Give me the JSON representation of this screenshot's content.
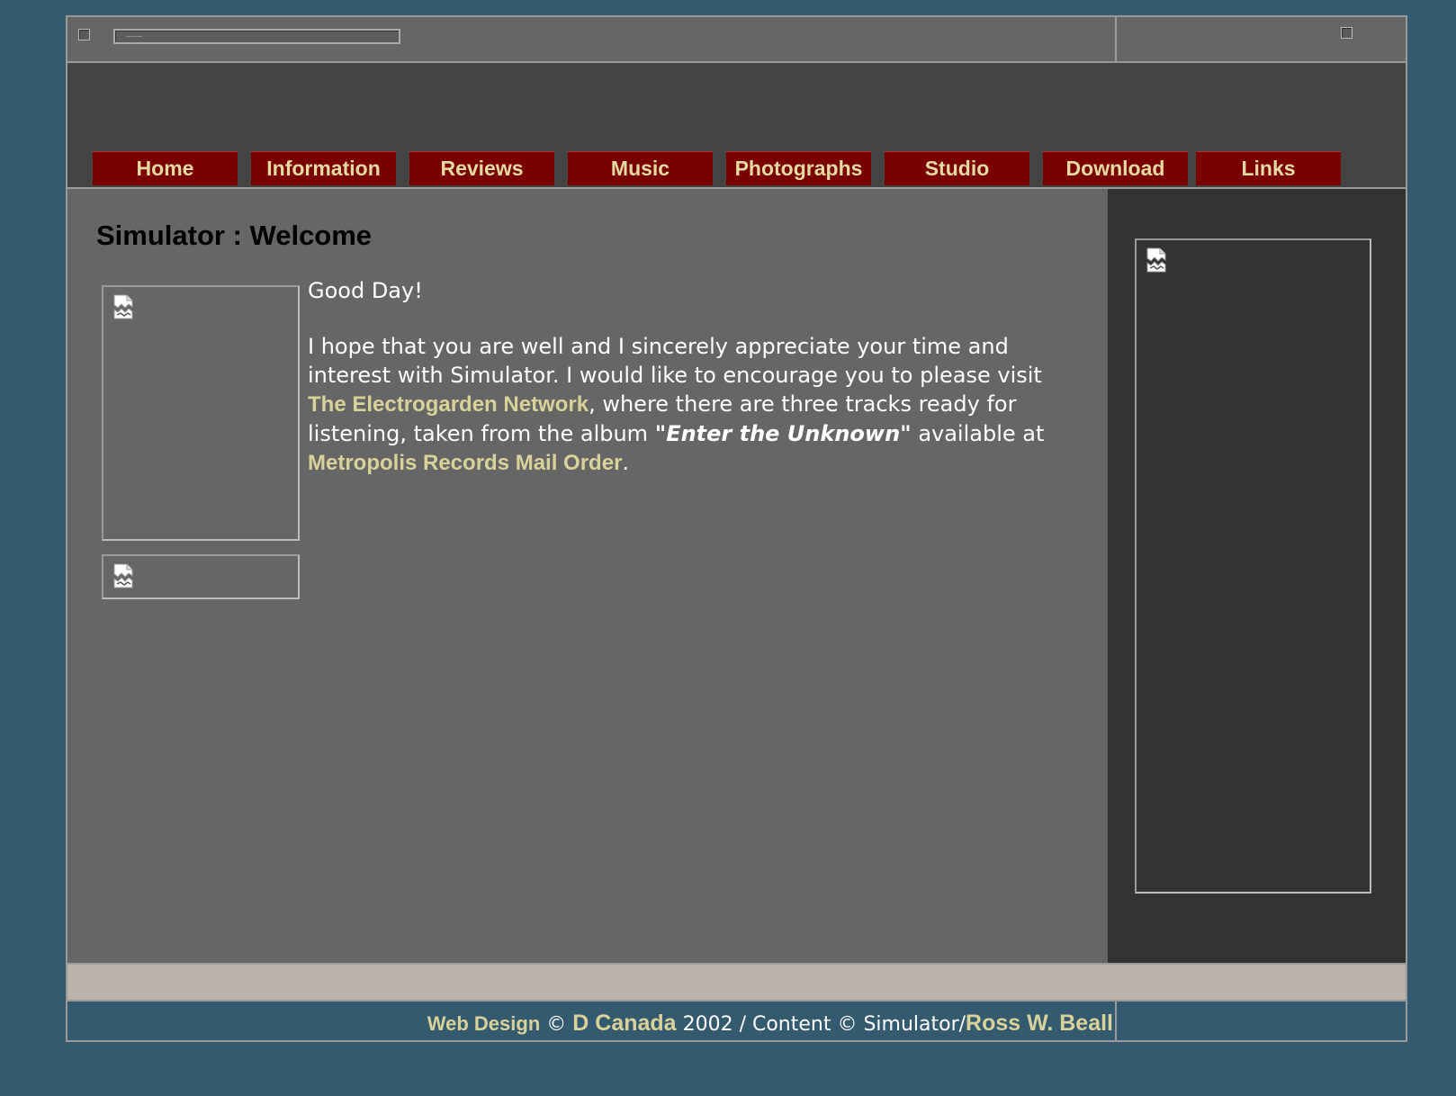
{
  "nav": {
    "items": [
      "Home",
      "Information",
      "Reviews",
      "Music",
      "Photographs",
      "Studio",
      "Download",
      "Links"
    ]
  },
  "main": {
    "title": "Simulator : Welcome",
    "greeting": "Good Day!",
    "para_1": "I hope that you are well and I sincerely appreciate your time and interest with Simulator. I would like to encourage you to please visit ",
    "link_network": "The Electrogarden Network",
    "para_2": ", where there are three tracks ready for listening, taken from the album ",
    "album": "\"Enter the Unknown\"",
    "para_3": " available at ",
    "link_metropolis": "Metropolis Records Mail Order",
    "para_end": "."
  },
  "footer": {
    "web_design": "Web Design",
    "copy_1": " © ",
    "designer": "D Canada",
    "copy_2": " 2002 / Content © Simulator/",
    "author": "Ross W. Beall"
  },
  "colors": {
    "background": "#345a6f",
    "nav_bg": "#7a0000",
    "nav_text": "#e3dba2",
    "link": "#d8d29a"
  },
  "icons": [
    "broken-image-icon"
  ]
}
